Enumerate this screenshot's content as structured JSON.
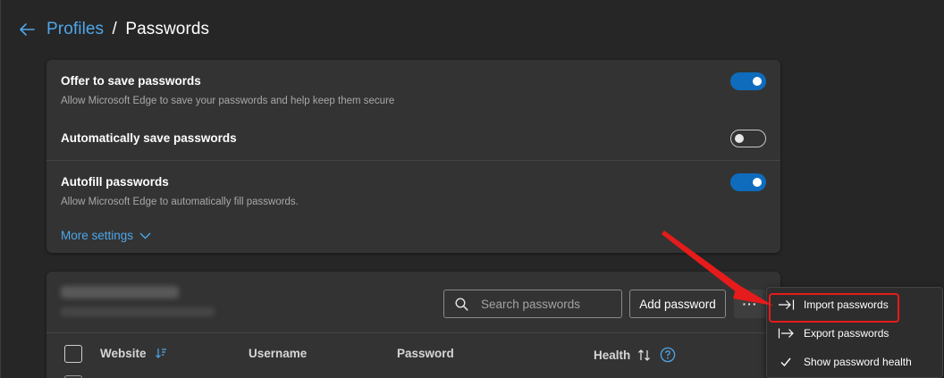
{
  "header": {
    "breadcrumb_link": "Profiles",
    "separator": "/",
    "title": "Passwords"
  },
  "settings": [
    {
      "title": "Offer to save passwords",
      "description": "Allow Microsoft Edge to save your passwords and help keep them secure",
      "enabled": true
    },
    {
      "title": "Automatically save passwords",
      "description": "",
      "enabled": false
    },
    {
      "title": "Autofill passwords",
      "description": "Allow Microsoft Edge to automatically fill passwords.",
      "enabled": true
    }
  ],
  "more_settings_label": "More settings",
  "passwords": {
    "search_placeholder": "Search passwords",
    "add_label": "Add password",
    "more_label": "···",
    "columns": [
      "Website",
      "Username",
      "Password",
      "Health"
    ]
  },
  "menu": {
    "items": [
      {
        "label": "Import passwords",
        "icon": "import-arrow-icon"
      },
      {
        "label": "Export passwords",
        "icon": "export-arrow-icon"
      },
      {
        "label": "Show password health",
        "icon": "checkmark-icon"
      }
    ]
  },
  "colors": {
    "accent": "#0f6cbd",
    "link": "#4ea6ea",
    "annotation": "#e61b1b",
    "background": "#262626",
    "card": "#333333"
  }
}
